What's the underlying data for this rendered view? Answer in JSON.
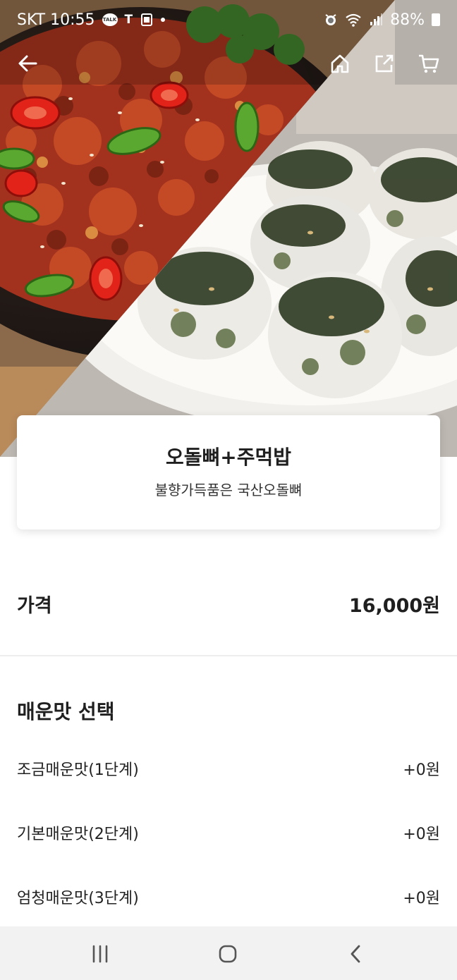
{
  "status_bar": {
    "carrier_time": "SKT 10:55",
    "battery": "88%",
    "icons": [
      "kakaotalk-icon",
      "tmap-icon",
      "clipboard-icon",
      "dot-icon",
      "alarm-icon",
      "wifi-icon",
      "signal-icon",
      "battery-icon"
    ]
  },
  "app_bar": {
    "icons": [
      "back-arrow-icon",
      "home-icon",
      "share-icon",
      "cart-icon"
    ]
  },
  "product": {
    "name": "오돌뼈+주먹밥",
    "description": "불향가득품은 국산오돌뼈"
  },
  "price": {
    "label": "가격",
    "value": "16,000원"
  },
  "spicy_options": {
    "title": "매운맛 선택",
    "items": [
      {
        "label": "조금매운맛(1단계)",
        "price": "+0원"
      },
      {
        "label": "기본매운맛(2단계)",
        "price": "+0원"
      },
      {
        "label": "엄청매운맛(3단계)",
        "price": "+0원"
      }
    ]
  },
  "nav_bar": {
    "icons": [
      "recent-apps-icon",
      "home-circle-icon",
      "back-chevron-icon"
    ]
  },
  "colors": {
    "status_text": "#ffffff",
    "text_primary": "#1f1f1f",
    "divider": "#ededed",
    "nav_background": "#f2f2f2"
  }
}
